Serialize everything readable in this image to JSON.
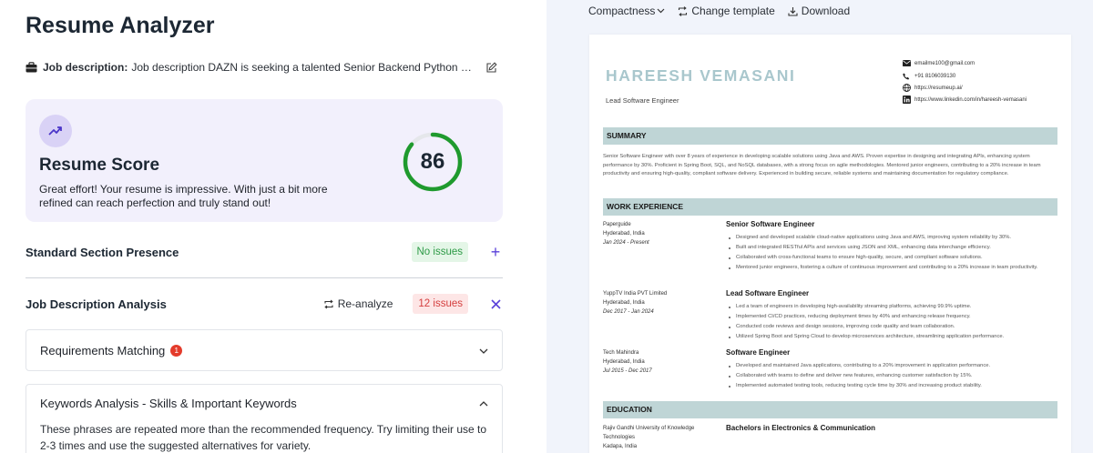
{
  "app": {
    "title": "Resume Analyzer"
  },
  "job_description": {
    "label": "Job description:",
    "text": "Job description DAZN is seeking a talented Senior Backend Python Developer to join our team"
  },
  "score": {
    "title": "Resume Score",
    "value": 86,
    "percent": 86,
    "description": "Great effort! Your resume is impressive. With just a bit more refined can reach perfection and truly stand out!",
    "gauge_color": "#1f9a2e",
    "track_color": "#e5e7eb"
  },
  "sections": {
    "standard": {
      "title": "Standard Section Presence",
      "badge": "No issues"
    },
    "jd_analysis": {
      "title": "Job Description Analysis",
      "reanalyze_label": "Re-analyze",
      "badge": "12 issues"
    }
  },
  "accordions": {
    "requirements": {
      "title": "Requirements Matching",
      "count": "1"
    },
    "keywords": {
      "title": "Keywords Analysis - Skills & Important Keywords",
      "body": "These phrases are repeated more than the recommended frequency. Try limiting their use to 2-3 times and use the suggested alternatives for variety."
    }
  },
  "toolbar": {
    "compactness": "Compactness",
    "change_template": "Change template",
    "download": "Download"
  },
  "resume": {
    "name": "HAREESH VEMASANI",
    "role": "Lead Software Engineer",
    "contacts": {
      "email": "emailme100@gmail.com",
      "phone": "+91 8106039130",
      "website": "https://resumeup.ai/",
      "linkedin": "https://www.linkedin.com/in/hareesh-vemasani"
    },
    "summary_heading": "SUMMARY",
    "summary": "Senior Software Engineer with over 8 years of experience in developing scalable solutions using Java and AWS. Proven expertise in designing and integrating APIs, enhancing system performance by 30%. Proficient in Spring Boot, SQL, and NoSQL databases, with a strong focus on agile methodologies. Mentored junior engineers, contributing to a 20% increase in team productivity and ensuring high-quality, compliant software delivery. Experienced in building secure, reliable systems and maintaining documentation for regulatory compliance.",
    "work_heading": "WORK EXPERIENCE",
    "jobs": [
      {
        "company": "Paperguide",
        "location": "Hyderabad, India",
        "dates": "Jan 2024 - Present",
        "title": "Senior Software Engineer",
        "bullets": [
          "Designed and developed scalable cloud-native applications using Java and AWS, improving system reliability by 30%.",
          "Built and integrated RESTful APIs and services using JSON and XML, enhancing data interchange efficiency.",
          "Collaborated with cross-functional teams to ensure high-quality, secure, and compliant software solutions.",
          "Mentored junior engineers, fostering a culture of continuous improvement and contributing to a 20% increase in team productivity."
        ]
      },
      {
        "company": "YuppTV India PVT Limited",
        "location": "Hyderabad, India",
        "dates": "Dec 2017 - Jan 2024",
        "title": "Lead Software Engineer",
        "bullets": [
          "Led a team of engineers in developing high-availability streaming platforms, achieving 99.9% uptime.",
          "Implemented CI/CD practices, reducing deployment times by 40% and enhancing release frequency.",
          "Conducted code reviews and design sessions, improving code quality and team collaboration.",
          "Utilized Spring Boot and Spring Cloud to develop microservices architecture, streamlining application performance."
        ]
      },
      {
        "company": "Tech Mahindra",
        "location": "Hyderabad, India",
        "dates": "Jul 2015 - Dec 2017",
        "title": "Software Engineer",
        "bullets": [
          "Developed and maintained Java applications, contributing to a 20% improvement in application performance.",
          "Collaborated with teams to define and deliver new features, enhancing customer satisfaction by 15%.",
          "Implemented automated testing tools, reducing testing cycle time by 30% and increasing product stability."
        ]
      }
    ],
    "education_heading": "EDUCATION",
    "education": {
      "school": "Rajiv Gandhi University of Knowledge Technologies",
      "location": "Kadapa, India",
      "degree": "Bachelors in Electronics & Communication"
    }
  }
}
